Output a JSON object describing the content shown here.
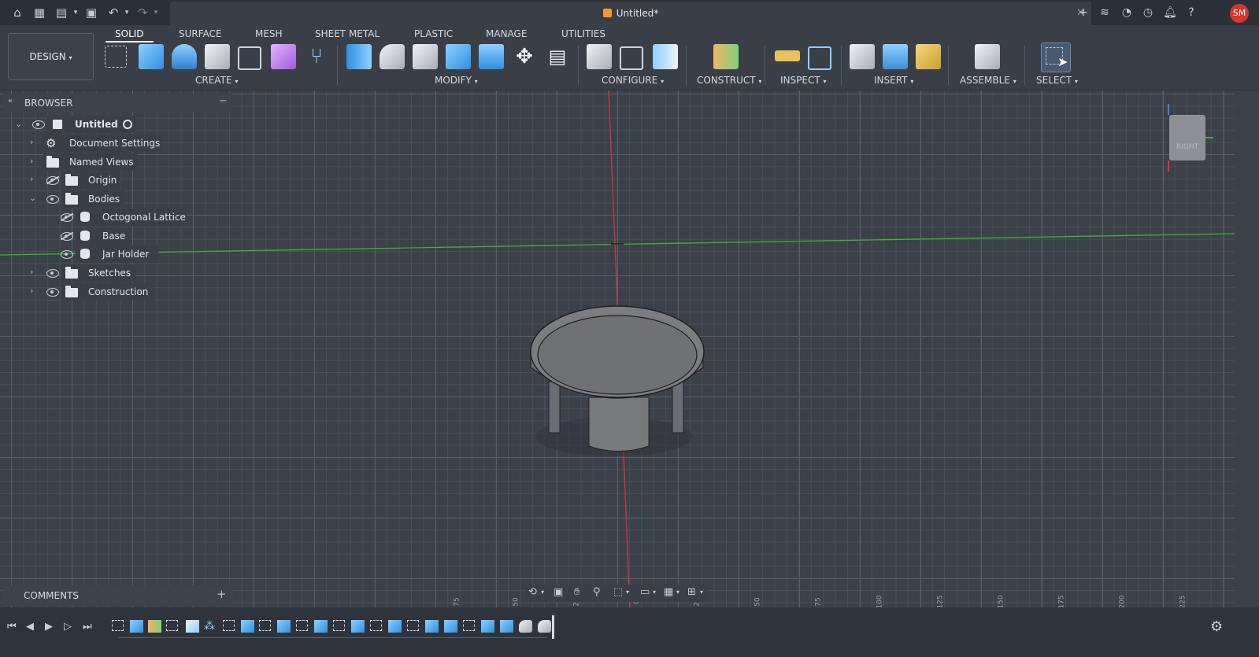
{
  "app": {
    "document_title": "Untitled*",
    "user_initials": "SM"
  },
  "quick_access": [
    "home-icon",
    "grid-apps-icon",
    "file-icon",
    "save-icon",
    "undo-icon",
    "redo-icon"
  ],
  "right_actions": [
    "add-tab-icon",
    "extensions-icon",
    "online-status-icon",
    "job-status-icon",
    "notifications-icon",
    "help-icon"
  ],
  "workspace": {
    "label": "DESIGN"
  },
  "tabs": [
    {
      "label": "SOLID",
      "active": true
    },
    {
      "label": "SURFACE"
    },
    {
      "label": "MESH"
    },
    {
      "label": "SHEET METAL"
    },
    {
      "label": "PLASTIC"
    },
    {
      "label": "MANAGE"
    },
    {
      "label": "UTILITIES"
    }
  ],
  "groups": [
    "CREATE",
    "MODIFY",
    "CONFIGURE",
    "CONSTRUCT",
    "INSPECT",
    "INSERT",
    "ASSEMBLE",
    "SELECT"
  ],
  "browser": {
    "title": "BROWSER",
    "root": "Untitled",
    "items": [
      {
        "label": "Document Settings",
        "icon": "gear-icon"
      },
      {
        "label": "Named Views",
        "icon": "folder-icon"
      },
      {
        "label": "Origin",
        "icon": "folder-icon",
        "visible": false
      },
      {
        "label": "Bodies",
        "icon": "folder-icon",
        "expanded": true
      },
      {
        "label": "Octogonal Lattice",
        "icon": "body-icon",
        "visible": false
      },
      {
        "label": "Base",
        "icon": "body-icon",
        "visible": false
      },
      {
        "label": "Jar Holder",
        "icon": "body-icon",
        "visible": true
      },
      {
        "label": "Sketches",
        "icon": "folder-icon"
      },
      {
        "label": "Construction",
        "icon": "folder-icon"
      }
    ]
  },
  "comments": {
    "title": "COMMENTS"
  },
  "viewcube": {
    "face": "RIGHT"
  },
  "ruler": [
    "75",
    "50",
    "25",
    "0",
    "25",
    "50",
    "75",
    "100",
    "125",
    "150",
    "175",
    "200",
    "225"
  ],
  "colors": {
    "accent": "#f29c2a",
    "avatar": "#d9352c",
    "x_axis": "#d33a3a",
    "y_axis": "#3fae3f"
  }
}
